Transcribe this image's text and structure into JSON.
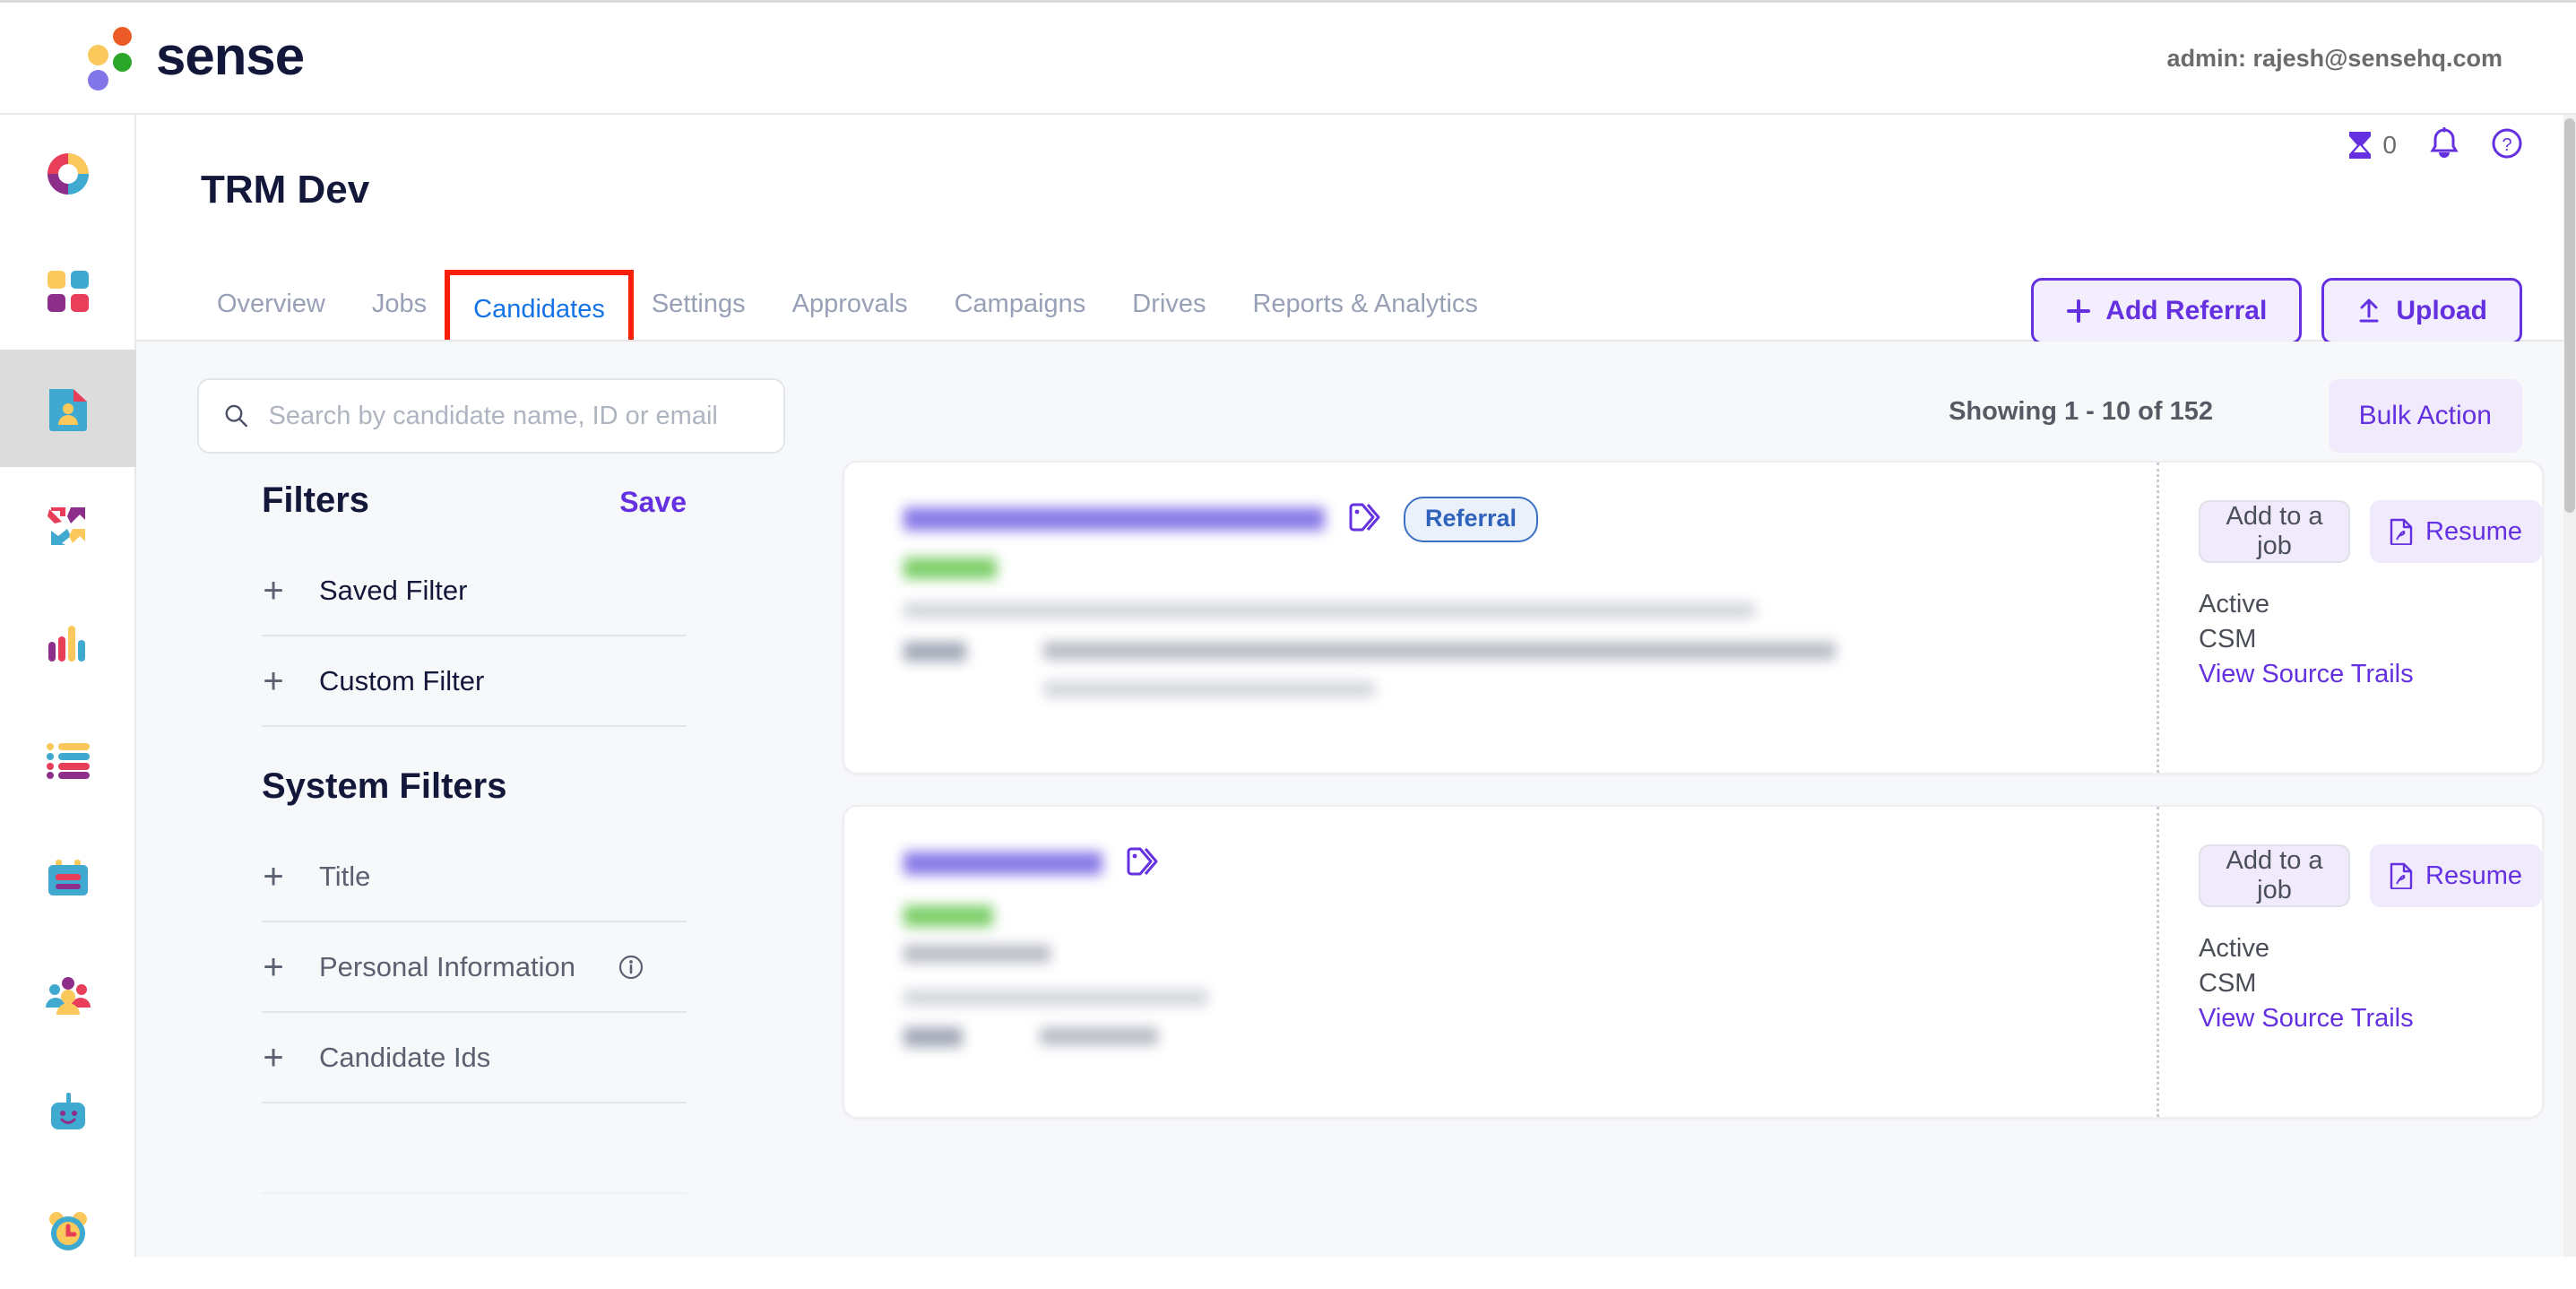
{
  "brand": {
    "name": "sense",
    "accent": "#6430e0",
    "logo_dots": [
      "orange",
      "yellow",
      "green",
      "purple"
    ]
  },
  "topbar": {
    "admin_label": "admin: rajesh@sensehq.com"
  },
  "utilities": {
    "hourglass_count": "0",
    "icons": [
      "hourglass-icon",
      "bell-icon",
      "help-icon"
    ]
  },
  "rail": {
    "items": [
      {
        "name": "donut-chart-icon",
        "active": false
      },
      {
        "name": "grid-squares-icon",
        "active": false
      },
      {
        "name": "candidate-document-icon",
        "active": true
      },
      {
        "name": "four-arrows-icon",
        "active": false
      },
      {
        "name": "bar-chart-icon",
        "active": false
      },
      {
        "name": "list-icon",
        "active": false
      },
      {
        "name": "calendar-icon",
        "active": false
      },
      {
        "name": "people-group-icon",
        "active": false
      },
      {
        "name": "chatbot-icon",
        "active": false
      },
      {
        "name": "alarm-clock-icon",
        "active": false
      }
    ]
  },
  "header": {
    "title": "TRM Dev",
    "tabs": [
      {
        "label": "Overview",
        "active": false,
        "highlighted": false
      },
      {
        "label": "Jobs",
        "active": false,
        "highlighted": false
      },
      {
        "label": "Candidates",
        "active": true,
        "highlighted": true
      },
      {
        "label": "Settings",
        "active": false,
        "highlighted": false
      },
      {
        "label": "Approvals",
        "active": false,
        "highlighted": false
      },
      {
        "label": "Campaigns",
        "active": false,
        "highlighted": false
      },
      {
        "label": "Drives",
        "active": false,
        "highlighted": false
      },
      {
        "label": "Reports & Analytics",
        "active": false,
        "highlighted": false
      }
    ],
    "actions": [
      {
        "label": "Add Referral",
        "icon": "plus-icon"
      },
      {
        "label": "Upload",
        "icon": "upload-arrow-icon"
      }
    ]
  },
  "toolbar": {
    "search_placeholder": "Search by candidate name, ID or email",
    "search_value": "",
    "showing_text": "Showing 1 - 10 of 152",
    "bulk_action_label": "Bulk Action"
  },
  "filters": {
    "title": "Filters",
    "save_label": "Save",
    "groups": [
      {
        "label": "Saved Filter",
        "muted": false
      },
      {
        "label": "Custom Filter",
        "muted": false
      }
    ],
    "system_title": "System Filters",
    "system_items": [
      {
        "label": "Title",
        "muted": true,
        "info": false
      },
      {
        "label": "Personal Information",
        "muted": true,
        "info": true
      },
      {
        "label": "Candidate Ids",
        "muted": true,
        "info": false
      }
    ]
  },
  "candidates": [
    {
      "name_redacted": true,
      "badge": "Referral",
      "has_badge": true,
      "tag_icon": "tag-icon",
      "add_to_job_label": "Add to a job",
      "resume_label": "Resume",
      "resume_icon": "pdf-file-icon",
      "status": "Active",
      "role": "CSM",
      "source_link": "View Source Trails"
    },
    {
      "name_redacted": true,
      "badge": "",
      "has_badge": false,
      "tag_icon": "tag-icon",
      "add_to_job_label": "Add to a job",
      "resume_label": "Resume",
      "resume_icon": "pdf-file-icon",
      "status": "Active",
      "role": "CSM",
      "source_link": "View Source Trails"
    }
  ]
}
